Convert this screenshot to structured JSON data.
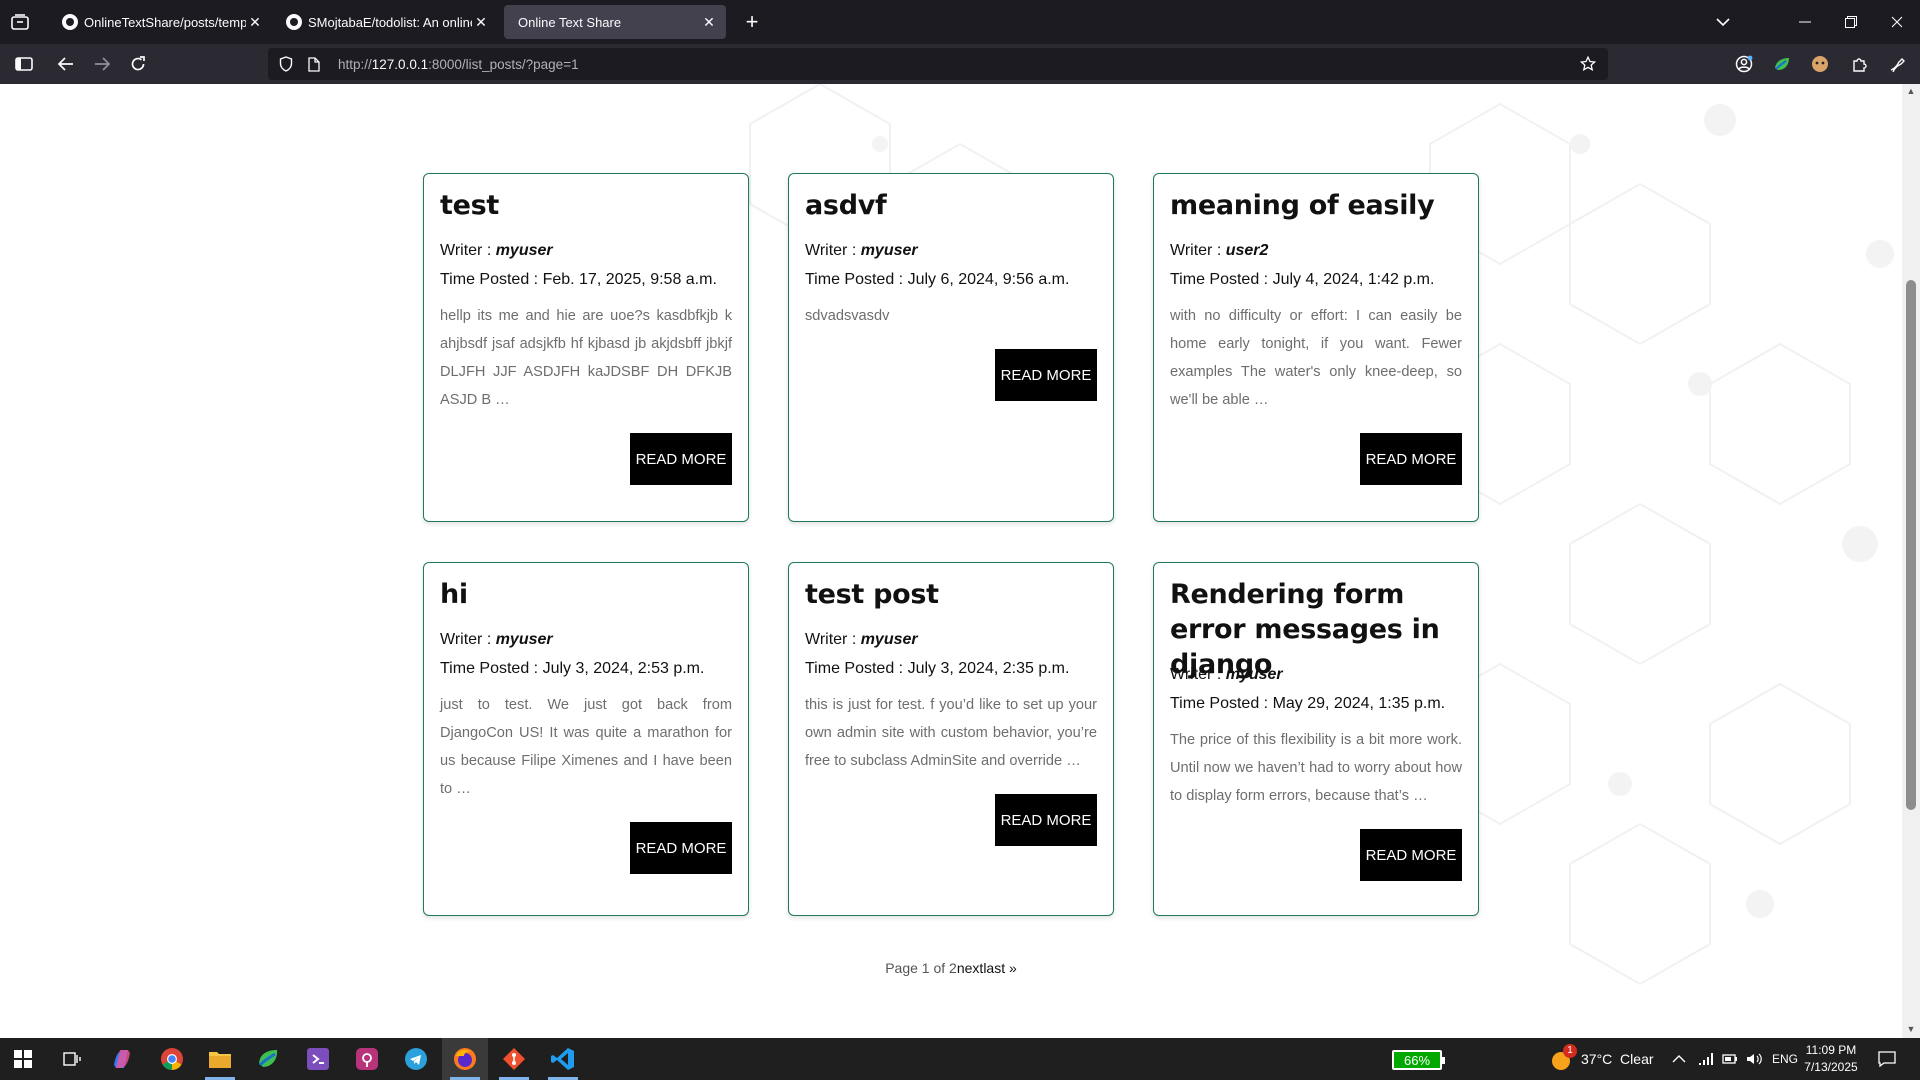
{
  "browser": {
    "tabs": [
      {
        "label": "OnlineTextShare/posts/templat",
        "active": false
      },
      {
        "label": "SMojtabaE/todolist: An online T",
        "active": false
      },
      {
        "label": "Online Text Share",
        "active": true
      }
    ],
    "url_prefix": "http://",
    "url_host": "127.0.0.1",
    "url_rest": ":8000/list_posts/?page=1"
  },
  "posts": [
    {
      "title": "test",
      "writer_label": "Writer : ",
      "writer": "myuser",
      "time_label": "Time Posted : ",
      "time": "Feb. 17, 2025, 9:58 a.m.",
      "excerpt": "hellp its me and hie are uoe?s kasdbfkjb k ahjbsdf jsaf adsjkfb hf kjbasd jb akjdsbff jbkjf DLJFH JJF ASDJFH kaJDSBF DH DFKJB ASJD B …",
      "button": "READ MORE"
    },
    {
      "title": "asdvf",
      "writer_label": "Writer : ",
      "writer": "myuser",
      "time_label": "Time Posted : ",
      "time": "July 6, 2024, 9:56 a.m.",
      "excerpt": "sdvadsvasdv",
      "button": "READ MORE"
    },
    {
      "title": "meaning of easily",
      "writer_label": "Writer : ",
      "writer": "user2",
      "time_label": "Time Posted : ",
      "time": "July 4, 2024, 1:42 p.m.",
      "excerpt": "with no difficulty or effort: I can easily be home early tonight, if you want. Fewer examples The water's only knee-deep, so we'll be able …",
      "button": "READ MORE"
    },
    {
      "title": "hi",
      "writer_label": "Writer : ",
      "writer": "myuser",
      "time_label": "Time Posted : ",
      "time": "July 3, 2024, 2:53 p.m.",
      "excerpt": "just to test. We just got back from DjangoCon US! It was quite a marathon for us because Filipe Ximenes and I have been to …",
      "button": "READ MORE"
    },
    {
      "title": "test post",
      "writer_label": "Writer : ",
      "writer": "myuser",
      "time_label": "Time Posted : ",
      "time": "July 3, 2024, 2:35 p.m.",
      "excerpt": "this is just for test. f you’d like to set up your own admin site with custom behavior, you’re free to subclass AdminSite and override …",
      "button": "READ MORE"
    },
    {
      "title": "Rendering form error messages in django",
      "writer_label": "Writer : ",
      "writer": "myuser",
      "time_label": "Time Posted : ",
      "time": "May 29, 2024, 1:35 p.m.",
      "excerpt": "The price of this flexibility is a bit more work. Until now we haven’t had to worry about how to display form errors, because that’s …",
      "button": "READ MORE"
    }
  ],
  "pagination": {
    "status": "Page 1 of 2",
    "next": "next",
    "last": "last »"
  },
  "taskbar": {
    "battery": "66%",
    "weather_badge": "1",
    "weather": "37°C  Clear",
    "lang": "ENG",
    "time": "11:09 PM",
    "date": "7/13/2025"
  },
  "colors": {
    "card_border": "#1e7a5a",
    "button_bg": "#000000",
    "browser_dark": "#1c1b22"
  }
}
